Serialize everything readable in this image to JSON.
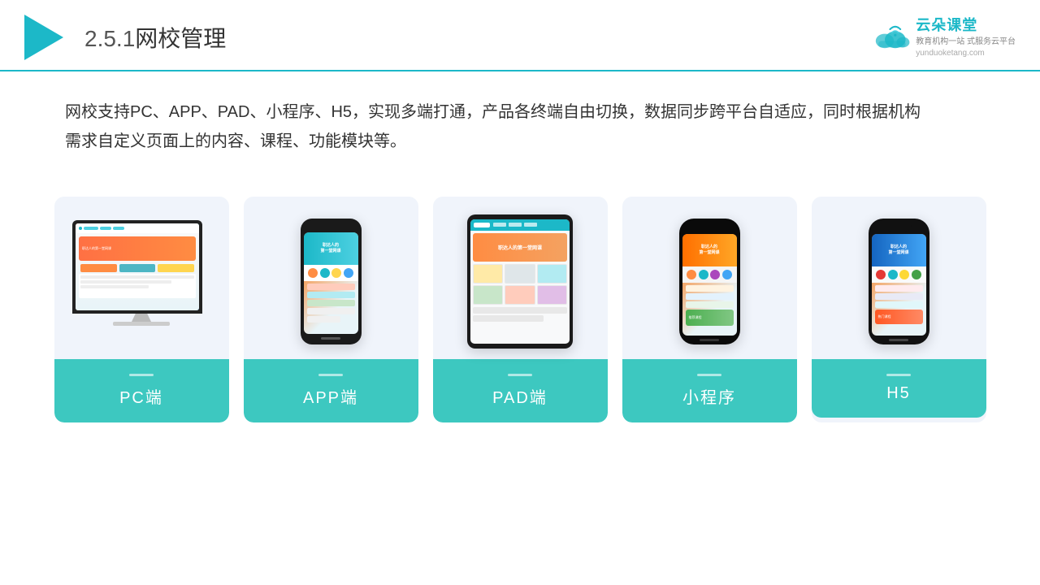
{
  "header": {
    "title_prefix": "2.5.1",
    "title_main": "网校管理",
    "brand": {
      "name": "云朵课堂",
      "url": "yunduoketang.com",
      "tagline": "教育机构一站\n式服务云平台"
    }
  },
  "description": {
    "text": "网校支持PC、APP、PAD、小程序、H5，实现多端打通，产品各终端自由切换，数据同步跨平台自适应，同时根据机构需求自定义页面上的内容、课程、功能模块等。"
  },
  "cards": [
    {
      "id": "pc",
      "label": "PC端"
    },
    {
      "id": "app",
      "label": "APP端"
    },
    {
      "id": "pad",
      "label": "PAD端"
    },
    {
      "id": "miniapp",
      "label": "小程序"
    },
    {
      "id": "h5",
      "label": "H5"
    }
  ],
  "colors": {
    "accent": "#1cb8c8",
    "card_bg": "#eef2fa",
    "label_bg": "#3dc8c0",
    "text_dark": "#333333",
    "header_border": "#1cb8c8"
  }
}
